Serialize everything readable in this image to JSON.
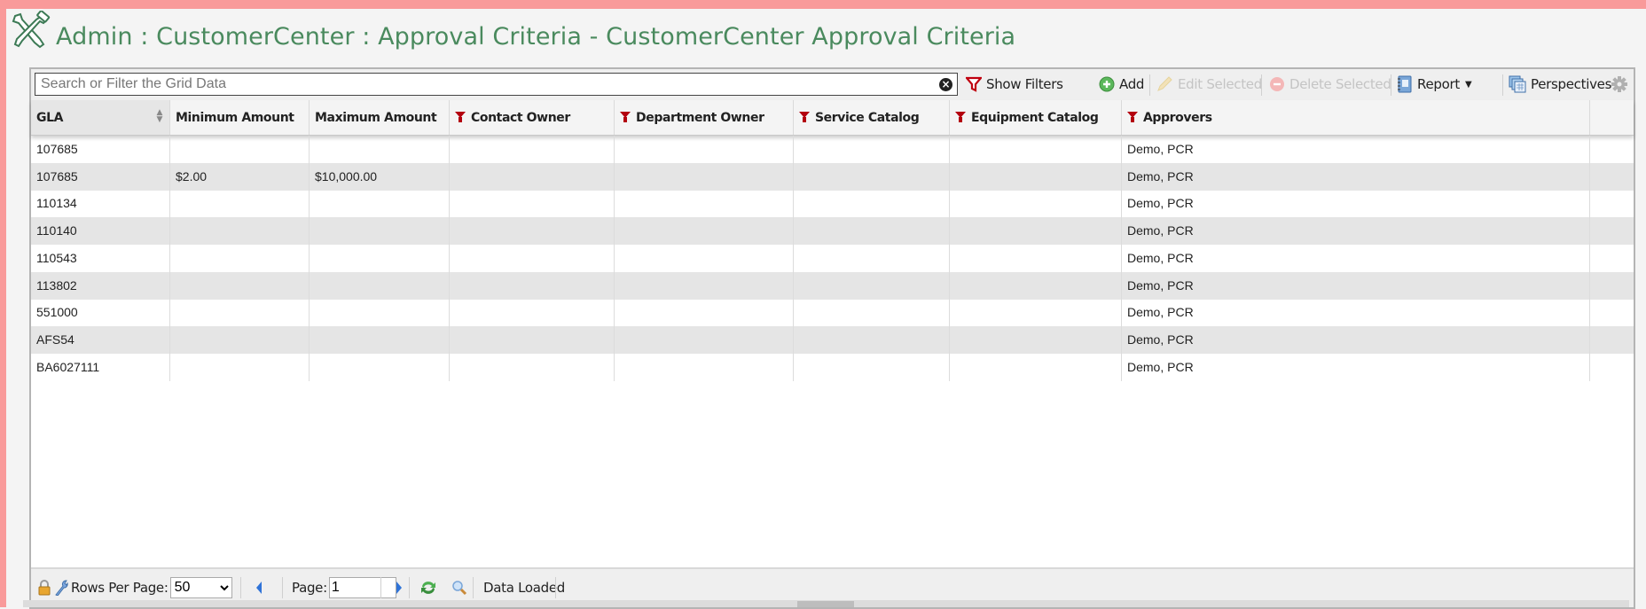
{
  "page": {
    "title": "Admin : CustomerCenter : Approval Criteria - CustomerCenter Approval Criteria",
    "logo_icon": "tools-wrench-hammer-icon",
    "accent_color": "#4a8a5e",
    "frame_color": "#f99a9a"
  },
  "toolbar": {
    "search_placeholder": "Search or Filter the Grid Data",
    "search_value": "",
    "clear_icon": "clear-circle-icon",
    "show_filters_label": "Show Filters",
    "add_label": "Add",
    "edit_selected_label": "Edit Selected",
    "delete_selected_label": "Delete Selected",
    "report_label": "Report",
    "perspectives_label": "Perspectives",
    "settings_icon": "gear-icon"
  },
  "grid": {
    "columns": [
      {
        "label": "GLA",
        "filter": false,
        "sortable": true
      },
      {
        "label": "Minimum Amount",
        "filter": false
      },
      {
        "label": "Maximum Amount",
        "filter": false
      },
      {
        "label": "Contact Owner",
        "filter": true
      },
      {
        "label": "Department Owner",
        "filter": true
      },
      {
        "label": "Service Catalog",
        "filter": true
      },
      {
        "label": "Equipment Catalog",
        "filter": true
      },
      {
        "label": "Approvers",
        "filter": true
      }
    ],
    "rows": [
      [
        "107685",
        "",
        "",
        "",
        "",
        "",
        "",
        "Demo, PCR"
      ],
      [
        "107685",
        "$2.00",
        "$10,000.00",
        "",
        "",
        "",
        "",
        "Demo, PCR"
      ],
      [
        "110134",
        "",
        "",
        "",
        "",
        "",
        "",
        "Demo, PCR"
      ],
      [
        "110140",
        "",
        "",
        "",
        "",
        "",
        "",
        "Demo, PCR"
      ],
      [
        "110543",
        "",
        "",
        "",
        "",
        "",
        "",
        "Demo, PCR"
      ],
      [
        "113802",
        "",
        "",
        "",
        "",
        "",
        "",
        "Demo, PCR"
      ],
      [
        "551000",
        "",
        "",
        "",
        "",
        "",
        "",
        "Demo, PCR"
      ],
      [
        "AFS54",
        "",
        "",
        "",
        "",
        "",
        "",
        "Demo, PCR"
      ],
      [
        "BA6027111",
        "",
        "",
        "",
        "",
        "",
        "",
        "Demo, PCR"
      ]
    ]
  },
  "footer": {
    "rows_per_page_label": "Rows Per Page:",
    "rows_per_page_value": "50",
    "page_label": "Page:",
    "page_value": "1",
    "status": "Data Loaded"
  }
}
